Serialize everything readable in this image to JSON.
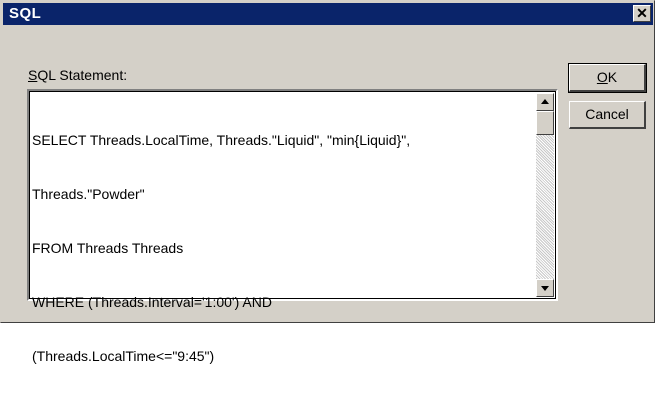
{
  "window": {
    "title": "SQL",
    "close_symbol": "✕"
  },
  "sql": {
    "label": "SQL Statement:",
    "label_mnemonic": "S",
    "label_rest": "QL Statement:",
    "statement_lines": [
      "SELECT Threads.LocalTime, Threads.\"Liquid\", \"min{Liquid}\",",
      "Threads.\"Powder\"",
      "FROM Threads Threads",
      "WHERE (Threads.Interval='1:00') AND",
      "(Threads.LocalTime<=\"9:45\")"
    ]
  },
  "buttons": {
    "ok_label": "OK",
    "ok_mnemonic": "O",
    "ok_rest": "K",
    "cancel_label": "Cancel"
  },
  "colors": {
    "titlebar": "#0a246a",
    "dialog_face": "#d4d0c8",
    "text_area": "#ffffff"
  },
  "icons": [
    "close-icon",
    "scroll-up-arrow-icon",
    "scroll-down-arrow-icon"
  ]
}
